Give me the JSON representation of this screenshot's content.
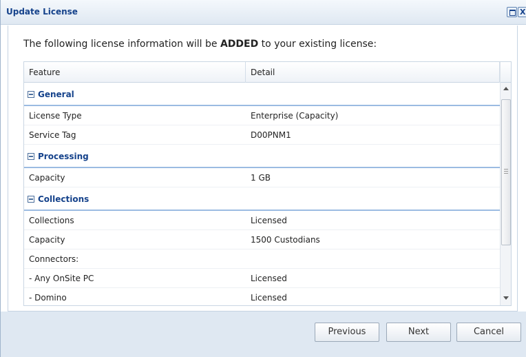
{
  "window": {
    "title": "Update License"
  },
  "intro": {
    "before": "The following license information will be ",
    "emphasis": "ADDED",
    "after": " to your existing license:"
  },
  "grid": {
    "columns": [
      "Feature",
      "Detail"
    ],
    "groups": [
      {
        "name": "General",
        "rows": [
          {
            "feature": "License Type",
            "detail": "Enterprise (Capacity)"
          },
          {
            "feature": "Service Tag",
            "detail": "D00PNM1"
          }
        ]
      },
      {
        "name": "Processing",
        "rows": [
          {
            "feature": "Capacity",
            "detail": "1 GB"
          }
        ]
      },
      {
        "name": "Collections",
        "rows": [
          {
            "feature": "Collections",
            "detail": "Licensed"
          },
          {
            "feature": "Capacity",
            "detail": "1500 Custodians"
          },
          {
            "feature": "Connectors:",
            "detail": ""
          },
          {
            "feature": "- Any OnSite PC",
            "detail": "Licensed"
          },
          {
            "feature": "- Domino",
            "detail": "Licensed"
          }
        ]
      }
    ]
  },
  "buttons": {
    "previous": "Previous",
    "next": "Next",
    "cancel": "Cancel"
  }
}
